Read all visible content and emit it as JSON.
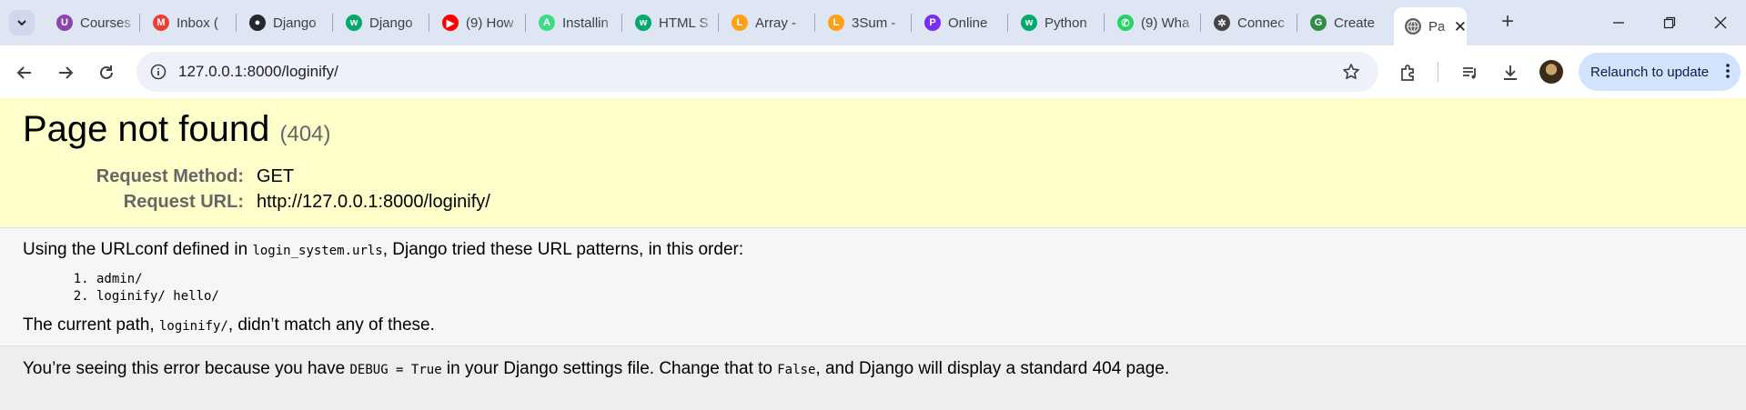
{
  "tabs": [
    {
      "title": "Courses",
      "icon": "course-icon",
      "color": "#8e44ad",
      "glyph": "U"
    },
    {
      "title": "Inbox (",
      "icon": "gmail-icon",
      "color": "#ea4335",
      "glyph": "M"
    },
    {
      "title": "Django",
      "icon": "github-icon",
      "color": "#24292f",
      "glyph": "●"
    },
    {
      "title": "Django",
      "icon": "w3schools-icon",
      "color": "#04aa6d",
      "glyph": "w"
    },
    {
      "title": "(9) How",
      "icon": "youtube-icon",
      "color": "#ff0000",
      "glyph": "▶"
    },
    {
      "title": "Installin",
      "icon": "android-icon",
      "color": "#3ddc84",
      "glyph": "A"
    },
    {
      "title": "HTML S",
      "icon": "w3schools-icon",
      "color": "#04aa6d",
      "glyph": "w"
    },
    {
      "title": "Array -",
      "icon": "leetcode-icon",
      "color": "#ffa116",
      "glyph": "L"
    },
    {
      "title": "3Sum -",
      "icon": "leetcode-icon",
      "color": "#ffa116",
      "glyph": "L"
    },
    {
      "title": "Online",
      "icon": "pi-icon",
      "color": "#7b2cf5",
      "glyph": "P"
    },
    {
      "title": "Python",
      "icon": "w3schools-icon",
      "color": "#04aa6d",
      "glyph": "w"
    },
    {
      "title": "(9) Wha",
      "icon": "whatsapp-icon",
      "color": "#25d366",
      "glyph": "✆"
    },
    {
      "title": "Connec",
      "icon": "openai-icon",
      "color": "#444444",
      "glyph": "✲"
    },
    {
      "title": "Create",
      "icon": "geeksforgeeks-icon",
      "color": "#2f8d46",
      "glyph": "G"
    }
  ],
  "active_tab": {
    "title": "Pa",
    "icon": "globe-icon",
    "close": "✕"
  },
  "toolbar": {
    "url": "127.0.0.1:8000/loginify/",
    "relaunch_label": "Relaunch to update"
  },
  "page": {
    "title": "Page not found",
    "code": "(404)",
    "meta": [
      {
        "key": "Request Method:",
        "value": "GET"
      },
      {
        "key": "Request URL:",
        "value": "http://127.0.0.1:8000/loginify/"
      }
    ],
    "urlconf_pre": "Using the URLconf defined in ",
    "urlconf_module": "login_system.urls",
    "urlconf_post": ", Django tried these URL patterns, in this order:",
    "patterns": [
      "admin/",
      "loginify/ hello/"
    ],
    "current_pre": "The current path, ",
    "current_path": "loginify/",
    "current_post": ", didn’t match any of these.",
    "explain_pre": "You’re seeing this error because you have ",
    "explain_debug": "DEBUG = True",
    "explain_mid": " in your Django settings file. Change that to ",
    "explain_false": "False",
    "explain_post": ", and Django will display a standard 404 page."
  }
}
